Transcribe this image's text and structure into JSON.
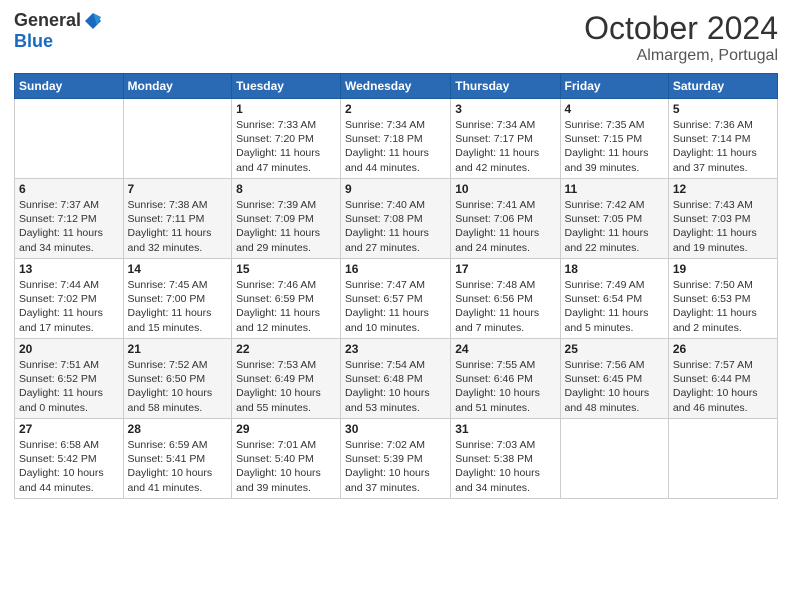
{
  "header": {
    "logo_general": "General",
    "logo_blue": "Blue",
    "month": "October 2024",
    "location": "Almargem, Portugal"
  },
  "weekdays": [
    "Sunday",
    "Monday",
    "Tuesday",
    "Wednesday",
    "Thursday",
    "Friday",
    "Saturday"
  ],
  "weeks": [
    [
      {
        "day": "",
        "sunrise": "",
        "sunset": "",
        "daylight": ""
      },
      {
        "day": "",
        "sunrise": "",
        "sunset": "",
        "daylight": ""
      },
      {
        "day": "1",
        "sunrise": "Sunrise: 7:33 AM",
        "sunset": "Sunset: 7:20 PM",
        "daylight": "Daylight: 11 hours and 47 minutes."
      },
      {
        "day": "2",
        "sunrise": "Sunrise: 7:34 AM",
        "sunset": "Sunset: 7:18 PM",
        "daylight": "Daylight: 11 hours and 44 minutes."
      },
      {
        "day": "3",
        "sunrise": "Sunrise: 7:34 AM",
        "sunset": "Sunset: 7:17 PM",
        "daylight": "Daylight: 11 hours and 42 minutes."
      },
      {
        "day": "4",
        "sunrise": "Sunrise: 7:35 AM",
        "sunset": "Sunset: 7:15 PM",
        "daylight": "Daylight: 11 hours and 39 minutes."
      },
      {
        "day": "5",
        "sunrise": "Sunrise: 7:36 AM",
        "sunset": "Sunset: 7:14 PM",
        "daylight": "Daylight: 11 hours and 37 minutes."
      }
    ],
    [
      {
        "day": "6",
        "sunrise": "Sunrise: 7:37 AM",
        "sunset": "Sunset: 7:12 PM",
        "daylight": "Daylight: 11 hours and 34 minutes."
      },
      {
        "day": "7",
        "sunrise": "Sunrise: 7:38 AM",
        "sunset": "Sunset: 7:11 PM",
        "daylight": "Daylight: 11 hours and 32 minutes."
      },
      {
        "day": "8",
        "sunrise": "Sunrise: 7:39 AM",
        "sunset": "Sunset: 7:09 PM",
        "daylight": "Daylight: 11 hours and 29 minutes."
      },
      {
        "day": "9",
        "sunrise": "Sunrise: 7:40 AM",
        "sunset": "Sunset: 7:08 PM",
        "daylight": "Daylight: 11 hours and 27 minutes."
      },
      {
        "day": "10",
        "sunrise": "Sunrise: 7:41 AM",
        "sunset": "Sunset: 7:06 PM",
        "daylight": "Daylight: 11 hours and 24 minutes."
      },
      {
        "day": "11",
        "sunrise": "Sunrise: 7:42 AM",
        "sunset": "Sunset: 7:05 PM",
        "daylight": "Daylight: 11 hours and 22 minutes."
      },
      {
        "day": "12",
        "sunrise": "Sunrise: 7:43 AM",
        "sunset": "Sunset: 7:03 PM",
        "daylight": "Daylight: 11 hours and 19 minutes."
      }
    ],
    [
      {
        "day": "13",
        "sunrise": "Sunrise: 7:44 AM",
        "sunset": "Sunset: 7:02 PM",
        "daylight": "Daylight: 11 hours and 17 minutes."
      },
      {
        "day": "14",
        "sunrise": "Sunrise: 7:45 AM",
        "sunset": "Sunset: 7:00 PM",
        "daylight": "Daylight: 11 hours and 15 minutes."
      },
      {
        "day": "15",
        "sunrise": "Sunrise: 7:46 AM",
        "sunset": "Sunset: 6:59 PM",
        "daylight": "Daylight: 11 hours and 12 minutes."
      },
      {
        "day": "16",
        "sunrise": "Sunrise: 7:47 AM",
        "sunset": "Sunset: 6:57 PM",
        "daylight": "Daylight: 11 hours and 10 minutes."
      },
      {
        "day": "17",
        "sunrise": "Sunrise: 7:48 AM",
        "sunset": "Sunset: 6:56 PM",
        "daylight": "Daylight: 11 hours and 7 minutes."
      },
      {
        "day": "18",
        "sunrise": "Sunrise: 7:49 AM",
        "sunset": "Sunset: 6:54 PM",
        "daylight": "Daylight: 11 hours and 5 minutes."
      },
      {
        "day": "19",
        "sunrise": "Sunrise: 7:50 AM",
        "sunset": "Sunset: 6:53 PM",
        "daylight": "Daylight: 11 hours and 2 minutes."
      }
    ],
    [
      {
        "day": "20",
        "sunrise": "Sunrise: 7:51 AM",
        "sunset": "Sunset: 6:52 PM",
        "daylight": "Daylight: 11 hours and 0 minutes."
      },
      {
        "day": "21",
        "sunrise": "Sunrise: 7:52 AM",
        "sunset": "Sunset: 6:50 PM",
        "daylight": "Daylight: 10 hours and 58 minutes."
      },
      {
        "day": "22",
        "sunrise": "Sunrise: 7:53 AM",
        "sunset": "Sunset: 6:49 PM",
        "daylight": "Daylight: 10 hours and 55 minutes."
      },
      {
        "day": "23",
        "sunrise": "Sunrise: 7:54 AM",
        "sunset": "Sunset: 6:48 PM",
        "daylight": "Daylight: 10 hours and 53 minutes."
      },
      {
        "day": "24",
        "sunrise": "Sunrise: 7:55 AM",
        "sunset": "Sunset: 6:46 PM",
        "daylight": "Daylight: 10 hours and 51 minutes."
      },
      {
        "day": "25",
        "sunrise": "Sunrise: 7:56 AM",
        "sunset": "Sunset: 6:45 PM",
        "daylight": "Daylight: 10 hours and 48 minutes."
      },
      {
        "day": "26",
        "sunrise": "Sunrise: 7:57 AM",
        "sunset": "Sunset: 6:44 PM",
        "daylight": "Daylight: 10 hours and 46 minutes."
      }
    ],
    [
      {
        "day": "27",
        "sunrise": "Sunrise: 6:58 AM",
        "sunset": "Sunset: 5:42 PM",
        "daylight": "Daylight: 10 hours and 44 minutes."
      },
      {
        "day": "28",
        "sunrise": "Sunrise: 6:59 AM",
        "sunset": "Sunset: 5:41 PM",
        "daylight": "Daylight: 10 hours and 41 minutes."
      },
      {
        "day": "29",
        "sunrise": "Sunrise: 7:01 AM",
        "sunset": "Sunset: 5:40 PM",
        "daylight": "Daylight: 10 hours and 39 minutes."
      },
      {
        "day": "30",
        "sunrise": "Sunrise: 7:02 AM",
        "sunset": "Sunset: 5:39 PM",
        "daylight": "Daylight: 10 hours and 37 minutes."
      },
      {
        "day": "31",
        "sunrise": "Sunrise: 7:03 AM",
        "sunset": "Sunset: 5:38 PM",
        "daylight": "Daylight: 10 hours and 34 minutes."
      },
      {
        "day": "",
        "sunrise": "",
        "sunset": "",
        "daylight": ""
      },
      {
        "day": "",
        "sunrise": "",
        "sunset": "",
        "daylight": ""
      }
    ]
  ]
}
